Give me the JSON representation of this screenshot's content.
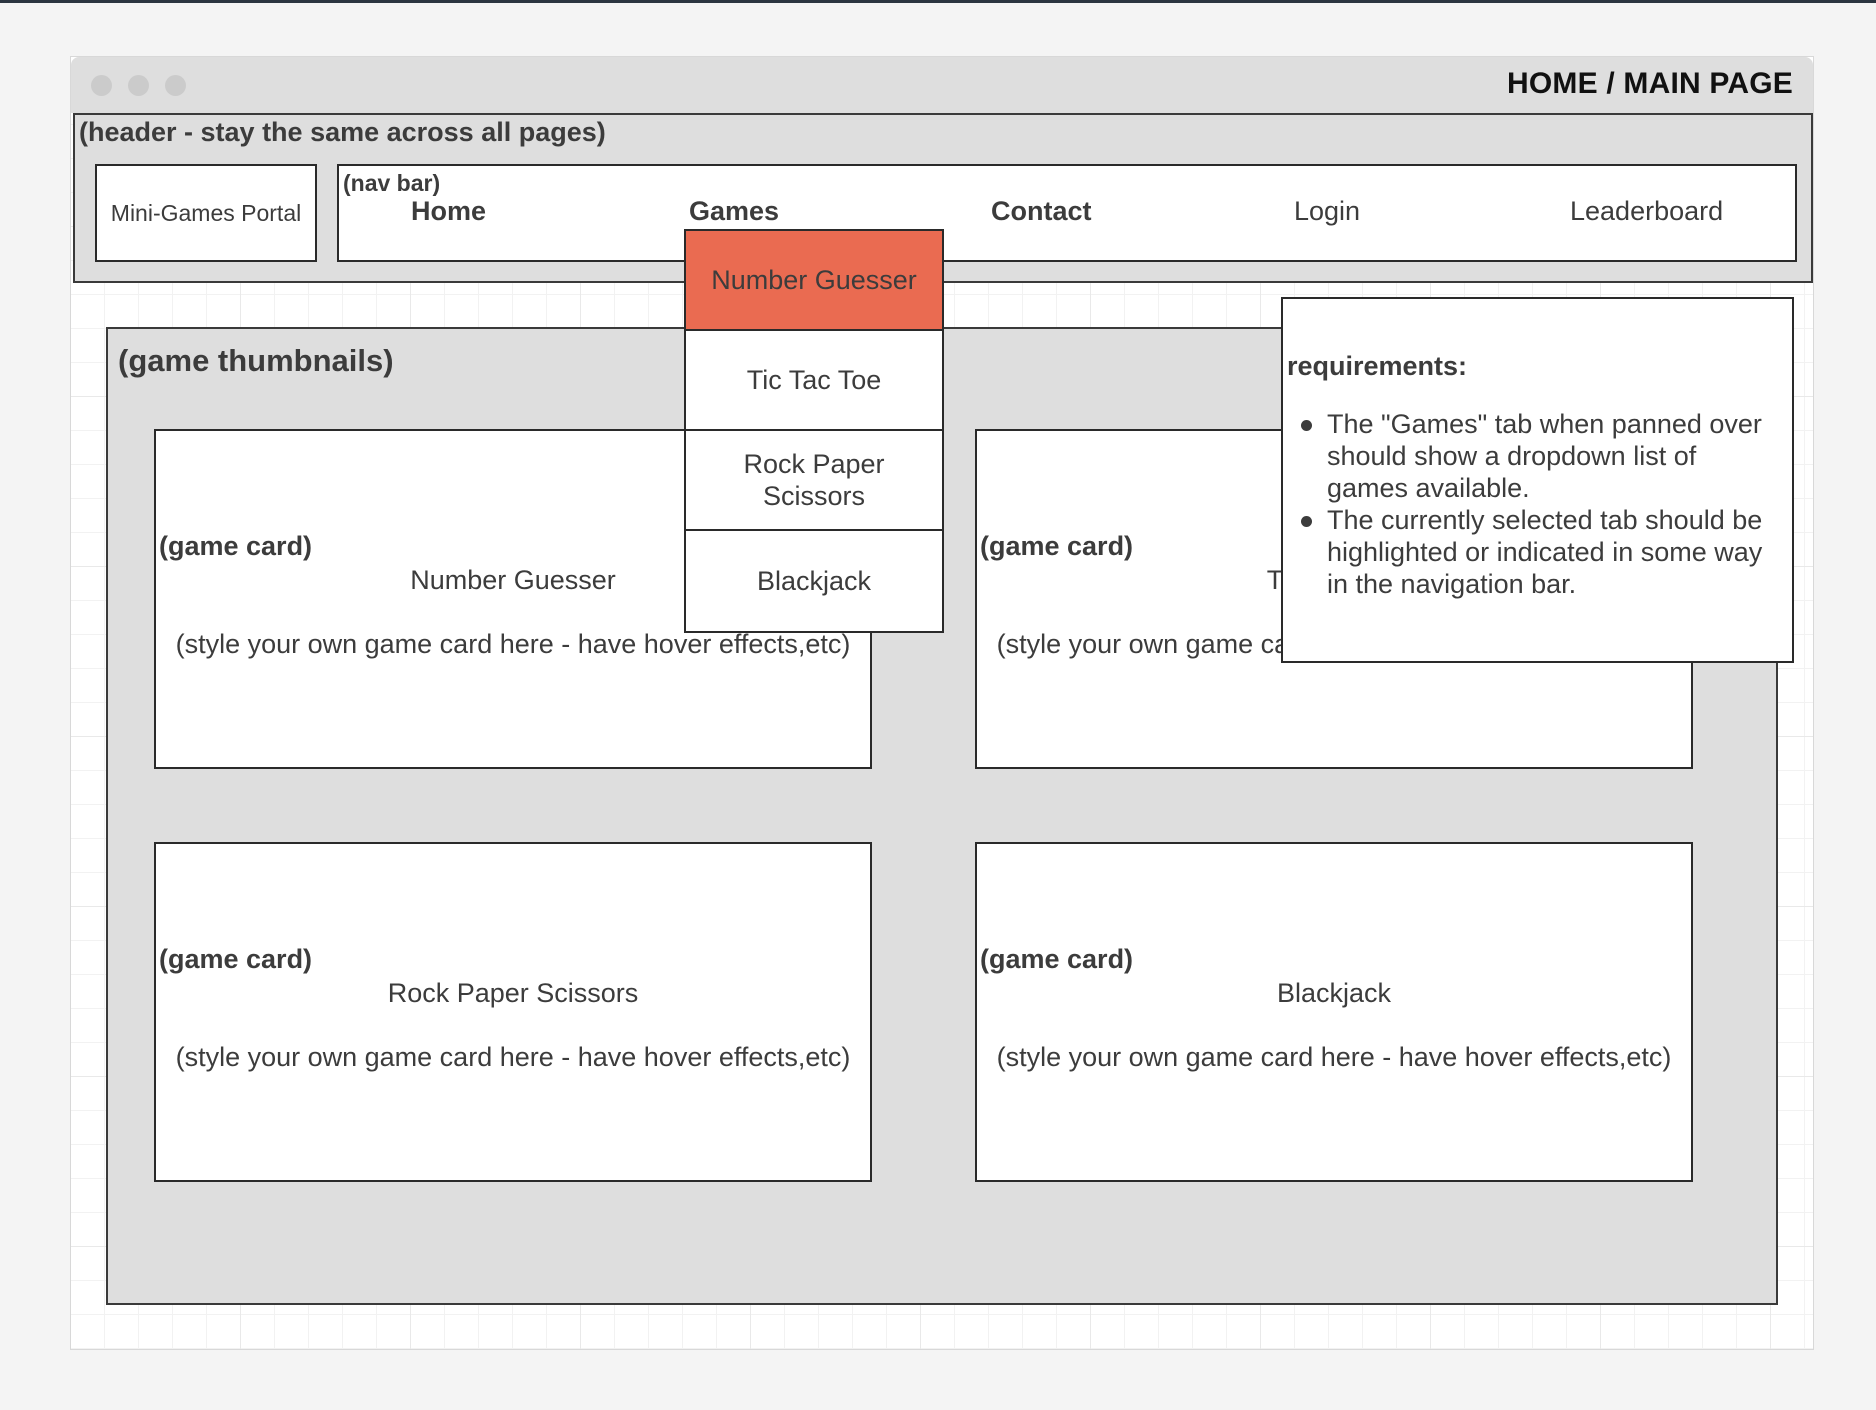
{
  "window": {
    "title": "HOME / MAIN PAGE"
  },
  "header": {
    "label": "(header - stay the same across all pages)",
    "logo": "Mini-Games Portal",
    "nav": {
      "label": "(nav bar)",
      "items": [
        {
          "label": "Home",
          "bold": true
        },
        {
          "label": "Games",
          "bold": true
        },
        {
          "label": "Contact",
          "bold": true
        },
        {
          "label": "Login",
          "bold": false
        },
        {
          "label": "Leaderboard",
          "bold": false
        }
      ]
    }
  },
  "dropdown": {
    "items": [
      "Number Guesser",
      "Tic Tac Toe",
      "Rock Paper Scissors",
      "Blackjack"
    ],
    "selected": "Number Guesser",
    "highlight_color": "#ea6b51"
  },
  "gallery": {
    "label": "(game thumbnails)",
    "cards": [
      {
        "tag": "(game card)",
        "title": "Number Guesser",
        "desc": "(style your own game card here - have hover effects,etc)"
      },
      {
        "tag": "(game card)",
        "title": "Tic Tac Toe",
        "desc": "(style your own game card here - have hover effects,etc)"
      },
      {
        "tag": "(game card)",
        "title": "Rock Paper Scissors",
        "desc": "(style your own game card here - have hover effects,etc)"
      },
      {
        "tag": "(game card)",
        "title": "Blackjack",
        "desc": "(style your own game card here - have hover effects,etc)"
      }
    ]
  },
  "requirements": {
    "title": "requirements:",
    "items": [
      "The \"Games\" tab when panned over should show a dropdown list of games available.",
      "The currently selected tab should be highlighted or indicated in some way in the navigation bar."
    ]
  }
}
